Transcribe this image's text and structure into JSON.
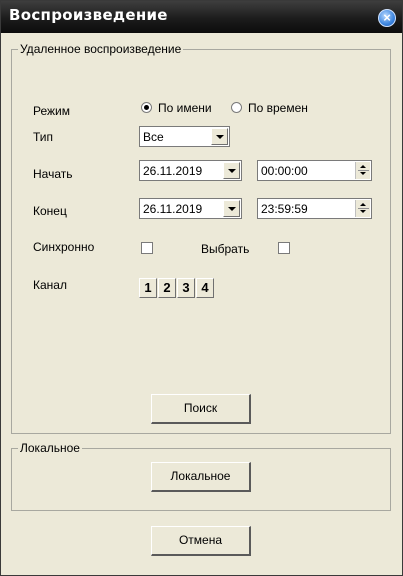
{
  "window": {
    "title": "Воспроизведение",
    "close_icon": "close-icon"
  },
  "remote": {
    "legend": "Удаленное воспроизведение",
    "mode": {
      "label": "Режим",
      "option_by_name": "По имени",
      "option_by_time": "По времен",
      "selected": "by_name"
    },
    "type": {
      "label": "Тип",
      "value": "Все"
    },
    "start": {
      "label": "Начать",
      "date": "26.11.2019",
      "time": "00:00:00"
    },
    "end": {
      "label": "Конец",
      "date": "26.11.2019",
      "time": "23:59:59"
    },
    "sync": {
      "label": "Синхронно",
      "checked": false
    },
    "select": {
      "label": "Выбрать",
      "checked": false
    },
    "channel": {
      "label": "Канал",
      "buttons": [
        "1",
        "2",
        "3",
        "4"
      ]
    },
    "search_button": "Поиск"
  },
  "local": {
    "legend": "Локальное",
    "button": "Локальное"
  },
  "cancel_button": "Отмена"
}
